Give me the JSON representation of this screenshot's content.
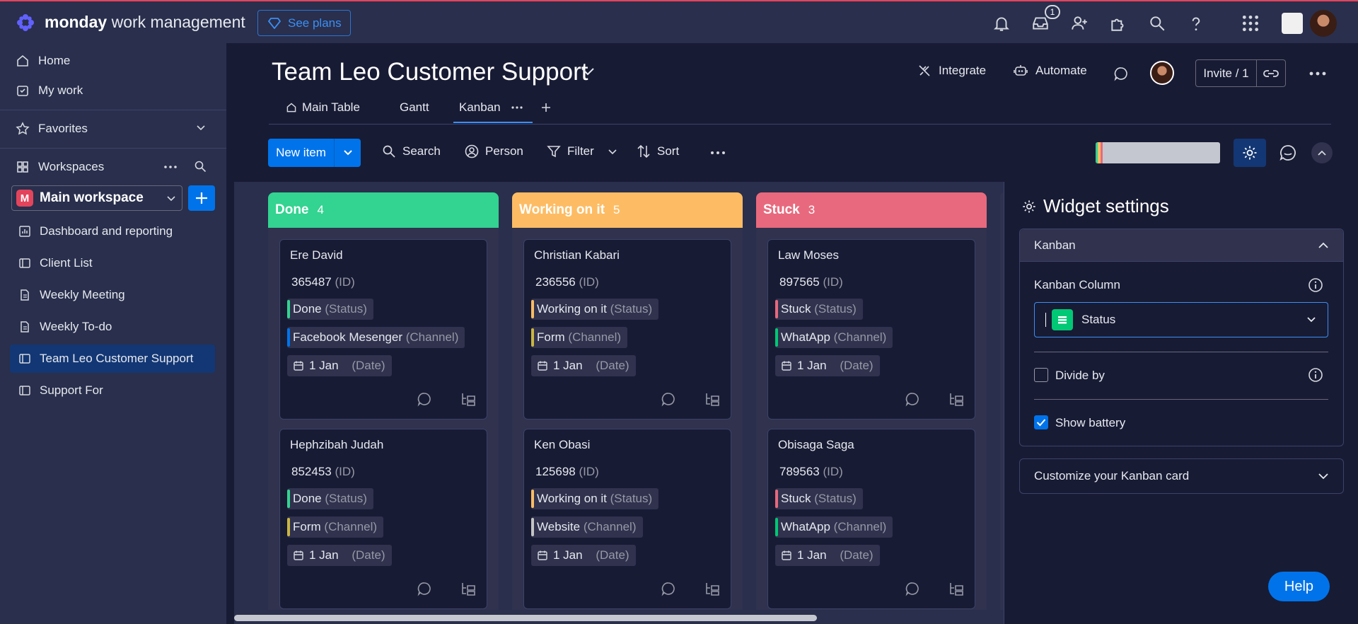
{
  "app": {
    "brand_bold": "monday",
    "brand_rest": " work management",
    "see_plans": "See plans",
    "notification_badge": "1"
  },
  "sidebar": {
    "home": "Home",
    "my_work": "My work",
    "favorites": "Favorites",
    "workspaces": "Workspaces",
    "workspace_initial": "M",
    "workspace_name": "Main workspace",
    "items": [
      {
        "label": "Dashboard and reporting",
        "icon": "dashboard-icon"
      },
      {
        "label": "Client List",
        "icon": "board-icon"
      },
      {
        "label": "Weekly Meeting",
        "icon": "doc-icon"
      },
      {
        "label": "Weekly To-do",
        "icon": "doc-icon"
      },
      {
        "label": "Team Leo Customer Support",
        "icon": "board-icon",
        "active": true
      },
      {
        "label": "Support For",
        "icon": "board-icon"
      }
    ]
  },
  "board": {
    "title": "Team Leo Customer Support",
    "integrate": "Integrate",
    "automate": "Automate",
    "invite": "Invite / 1",
    "tabs": [
      "Main Table",
      "Gantt",
      "Kanban"
    ],
    "active_tab": "Kanban"
  },
  "toolbar": {
    "new_item": "New item",
    "search": "Search",
    "person": "Person",
    "filter": "Filter",
    "sort": "Sort"
  },
  "kanban": {
    "columns": [
      {
        "name": "Done",
        "count": "4",
        "color": "#33d391",
        "cards": [
          {
            "name": "Ere David",
            "id": "365487",
            "status": "Done",
            "channel": "Facebook Mesenger",
            "date": "1 Jan",
            "channel_color": "#0073ea"
          },
          {
            "name": "Hephzibah Judah",
            "id": "852453",
            "status": "Done",
            "channel": "Form",
            "date": "1 Jan",
            "channel_color": "#cab641"
          }
        ]
      },
      {
        "name": "Working on it",
        "count": "5",
        "color": "#fdbc64",
        "cards": [
          {
            "name": "Christian Kabari",
            "id": "236556",
            "status": "Working on it",
            "channel": "Form",
            "date": "1 Jan",
            "channel_color": "#cab641"
          },
          {
            "name": "Ken Obasi",
            "id": "125698",
            "status": "Working on it",
            "channel": "Website",
            "date": "1 Jan",
            "channel_color": "#c4c4c4"
          }
        ]
      },
      {
        "name": "Stuck",
        "count": "3",
        "color": "#e8697d",
        "cards": [
          {
            "name": "Law Moses",
            "id": "897565",
            "status": "Stuck",
            "channel": "WhatApp",
            "date": "1 Jan",
            "channel_color": "#00c875"
          },
          {
            "name": "Obisaga Saga",
            "id": "789563",
            "status": "Stuck",
            "channel": "WhatApp",
            "date": "1 Jan",
            "channel_color": "#00c875"
          }
        ]
      }
    ],
    "labels": {
      "id": "(ID)",
      "status": "(Status)",
      "channel": "(Channel)",
      "date": "(Date)"
    }
  },
  "widget_settings": {
    "title": "Widget settings",
    "section_kanban": "Kanban",
    "kanban_column_label": "Kanban Column",
    "kanban_column_value": "Status",
    "divide_by": "Divide by",
    "divide_by_checked": false,
    "show_battery": "Show battery",
    "show_battery_checked": true,
    "customize_card": "Customize your Kanban card"
  },
  "help": "Help",
  "colors": {
    "accent": "#0073ea",
    "done": "#33d391",
    "working": "#fdbc64",
    "stuck": "#e8697d"
  }
}
